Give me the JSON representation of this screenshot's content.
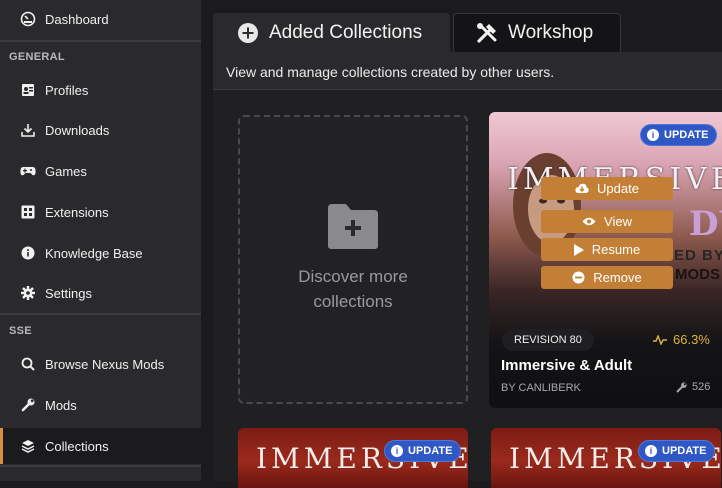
{
  "sidebar": {
    "top_item": {
      "label": "Dashboard",
      "icon": "dashboard-icon"
    },
    "sections": [
      {
        "title": "GENERAL"
      },
      {
        "title": "SSE"
      }
    ],
    "general_items": [
      {
        "label": "Profiles",
        "icon": "profiles-icon"
      },
      {
        "label": "Downloads",
        "icon": "download-icon"
      },
      {
        "label": "Games",
        "icon": "gamepad-icon"
      },
      {
        "label": "Extensions",
        "icon": "extensions-icon"
      },
      {
        "label": "Knowledge Base",
        "icon": "info-icon"
      },
      {
        "label": "Settings",
        "icon": "gear-icon"
      }
    ],
    "sse_items": [
      {
        "label": "Browse Nexus Mods",
        "icon": "search-icon"
      },
      {
        "label": "Mods",
        "icon": "wrench-icon"
      },
      {
        "label": "Collections",
        "icon": "layers-icon",
        "active": true
      }
    ],
    "accent_color": "#d98f40"
  },
  "tabs": [
    {
      "label": "Added Collections",
      "icon": "plus-circle-icon",
      "active": true
    },
    {
      "label": "Workshop",
      "icon": "tools-icon",
      "active": false
    }
  ],
  "description": "View and manage collections created by other users.",
  "discover": {
    "text": "Discover more collections",
    "icon": "folder-plus-icon"
  },
  "collection_card": {
    "art_title": "IMMERSIVE",
    "art_sub": "DULT",
    "art_sub2": "ED BY",
    "art_sub3": "MODS",
    "badge": "UPDATE",
    "actions": [
      {
        "label": "Update",
        "icon": "cloud-download-icon"
      },
      {
        "label": "View",
        "icon": "eye-icon"
      },
      {
        "label": "Resume",
        "icon": "play-icon"
      },
      {
        "label": "Remove",
        "icon": "minus-circle-icon"
      }
    ],
    "revision": "REVISION 80",
    "score": "66.3%",
    "name": "Immersive & Adult",
    "author": "BY CANLIBERK",
    "mod_count": "526",
    "accent_color": "#c47f36",
    "badge_color": "#2f58c4"
  },
  "bottom_cards": [
    {
      "art_title": "IMMERSIVE",
      "badge": "UPDATE"
    },
    {
      "art_title": "IMMERSIVE",
      "badge": "UPDATE"
    }
  ]
}
